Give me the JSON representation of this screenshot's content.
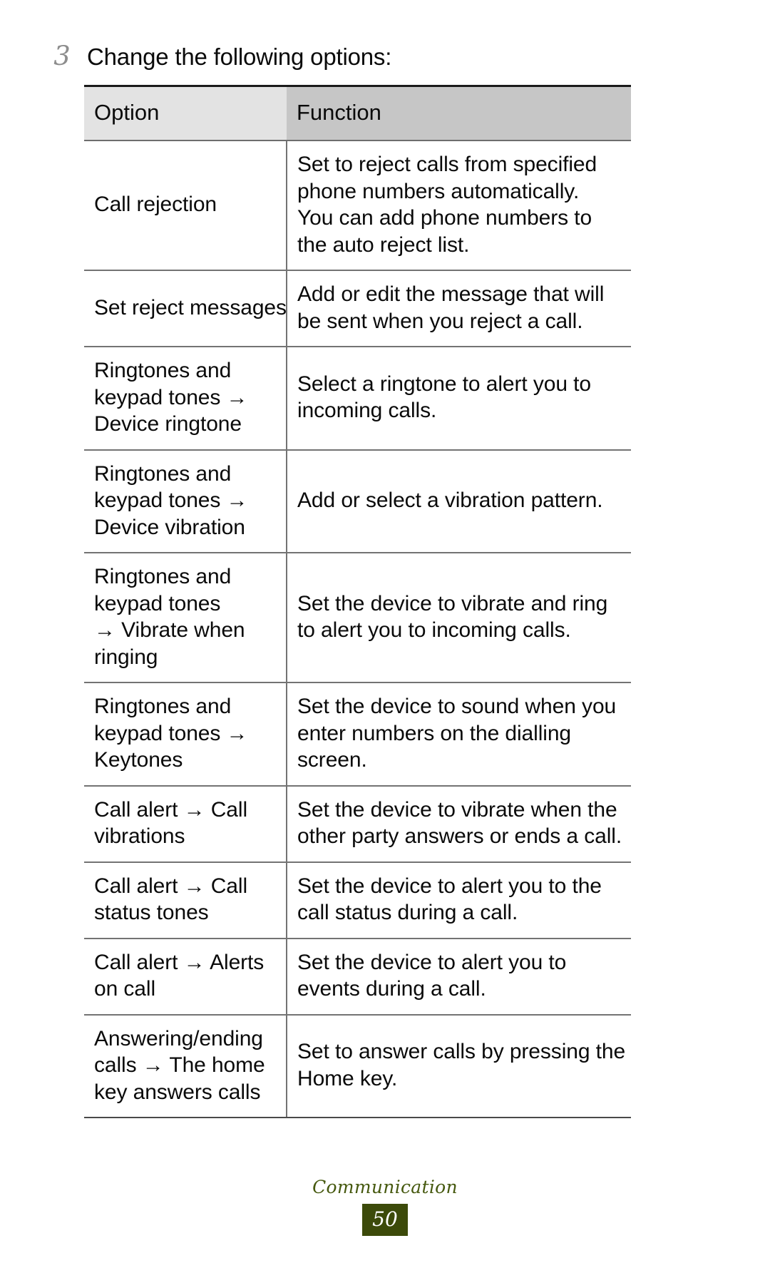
{
  "step": {
    "number": "3",
    "text": "Change the following options:"
  },
  "table": {
    "headers": {
      "option": "Option",
      "function": "Function"
    },
    "rows": [
      {
        "option_lines": [
          "Call rejection"
        ],
        "function_lines": [
          "Set to reject calls from specified",
          "phone numbers automatically.",
          "You can add phone numbers to",
          "the auto reject list."
        ]
      },
      {
        "option_lines": [
          "Set reject messages"
        ],
        "function_lines": [
          "Add or edit the message that will",
          "be sent when you reject a call."
        ]
      },
      {
        "option_lines": [
          "Ringtones and",
          "keypad tones →",
          "Device ringtone"
        ],
        "function_lines": [
          "Select a ringtone to alert you to",
          "incoming calls."
        ]
      },
      {
        "option_lines": [
          "Ringtones and",
          "keypad tones →",
          "Device vibration"
        ],
        "function_lines": [
          "Add or select a vibration pattern."
        ]
      },
      {
        "option_lines": [
          "Ringtones and",
          "keypad tones",
          "→ Vibrate when",
          "ringing"
        ],
        "function_lines": [
          "Set the device to vibrate and ring",
          "to alert you to incoming calls."
        ]
      },
      {
        "option_lines": [
          "Ringtones and",
          "keypad tones →",
          "Keytones"
        ],
        "function_lines": [
          "Set the device to sound when you",
          "enter numbers on the dialling",
          "screen."
        ]
      },
      {
        "option_lines": [
          "Call alert → Call",
          "vibrations"
        ],
        "function_lines": [
          "Set the device to vibrate when the",
          "other party answers or ends a call."
        ]
      },
      {
        "option_lines": [
          "Call alert → Call",
          "status tones"
        ],
        "function_lines": [
          "Set the device to alert you to the",
          "call status during a call."
        ]
      },
      {
        "option_lines": [
          "Call alert → Alerts",
          "on call"
        ],
        "function_lines": [
          "Set the device to alert you to",
          "events during a call."
        ]
      },
      {
        "option_lines": [
          "Answering/ending",
          "calls → The home",
          "key answers calls"
        ],
        "function_lines": [
          "Set to answer calls by pressing the",
          "Home key."
        ]
      }
    ]
  },
  "footer": {
    "section_title": "Communication",
    "page_number": "50"
  },
  "colors": {
    "header_option_bg": "#e3e3e3",
    "header_function_bg": "#c6c6c6",
    "footer_green": "#46590f",
    "page_badge_bg": "#3c4a0a",
    "step_number_gray": "#8d8d8d"
  }
}
